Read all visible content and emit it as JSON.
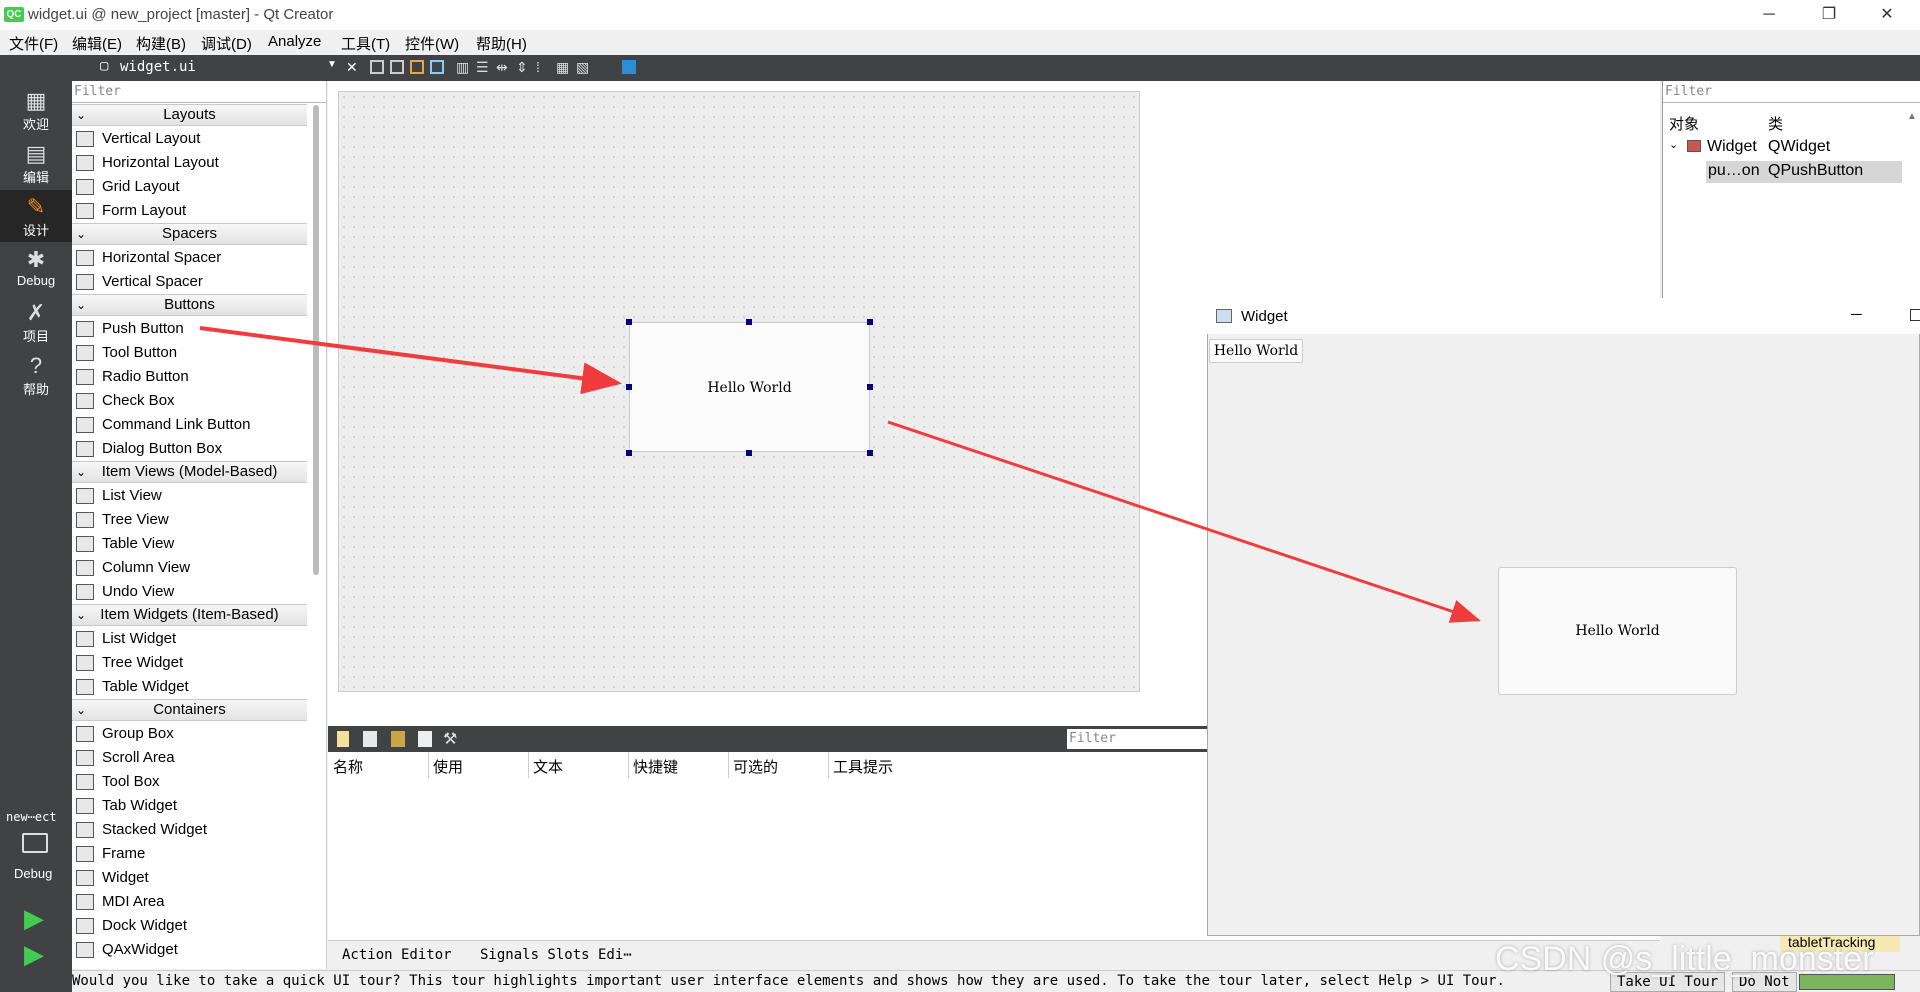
{
  "window": {
    "title": "widget.ui @ new_project [master] - Qt Creator",
    "logo": "QC",
    "minimize": "─",
    "restore": "❐",
    "close": "✕"
  },
  "menu": [
    "文件(F)",
    "编辑(E)",
    "构建(B)",
    "调试(D)",
    "Analyze",
    "工具(T)",
    "控件(W)",
    "帮助(H)"
  ],
  "modes": [
    {
      "label": "欢迎",
      "icon": "grid-icon"
    },
    {
      "label": "编辑",
      "icon": "edit-doc-icon"
    },
    {
      "label": "设计",
      "icon": "pencil-icon"
    },
    {
      "label": "Debug",
      "icon": "bug-icon"
    },
    {
      "label": "项目",
      "icon": "wrench-icon"
    },
    {
      "label": "帮助",
      "icon": "help-icon"
    }
  ],
  "bottom_mode": {
    "project": "new⋯ect",
    "kit": "Debug"
  },
  "editor_toolbar": {
    "file": "widget.ui",
    "close": "✕"
  },
  "widget_box": {
    "filter_placeholder": "Filter",
    "categories": [
      {
        "name": "Layouts",
        "items": [
          "Vertical Layout",
          "Horizontal Layout",
          "Grid Layout",
          "Form Layout"
        ]
      },
      {
        "name": "Spacers",
        "items": [
          "Horizontal Spacer",
          "Vertical Spacer"
        ]
      },
      {
        "name": "Buttons",
        "items": [
          "Push Button",
          "Tool Button",
          "Radio Button",
          "Check Box",
          "Command Link Button",
          "Dialog Button Box"
        ]
      },
      {
        "name": "Item Views (Model-Based)",
        "items": [
          "List View",
          "Tree View",
          "Table View",
          "Column View",
          "Undo View"
        ]
      },
      {
        "name": "Item Widgets (Item-Based)",
        "items": [
          "List Widget",
          "Tree Widget",
          "Table Widget"
        ]
      },
      {
        "name": "Containers",
        "items": [
          "Group Box",
          "Scroll Area",
          "Tool Box",
          "Tab Widget",
          "Stacked Widget",
          "Frame",
          "Widget",
          "MDI Area",
          "Dock Widget",
          "QAxWidget"
        ]
      }
    ]
  },
  "form": {
    "button_text": "Hello World"
  },
  "object_inspector": {
    "filter_placeholder": "Filter",
    "col_object": "对象",
    "col_class": "类",
    "rows": [
      {
        "object": "Widget",
        "class": "QWidget"
      },
      {
        "object": "pu…on",
        "class": "QPushButton"
      }
    ]
  },
  "action_editor": {
    "filter_placeholder": "Filter",
    "columns": [
      "名称",
      "使用",
      "文本",
      "快捷键",
      "可选的",
      "工具提示"
    ],
    "tabs": [
      "Action Editor",
      "Signals Slots Edi⋯"
    ]
  },
  "running_window": {
    "title": "Widget",
    "minimize": "─",
    "button1": "Hello World",
    "button2": "Hello World"
  },
  "property_hint": "tabletTracking",
  "status": {
    "message": "Would you like to take a quick UI tour? This tour highlights important user interface elements and shows how they are used. To take the tour later, select Help > UI Tour.",
    "tour_button": "Take UI Tour",
    "dismiss_button": "Do Not"
  },
  "watermark": "CSDN @s_little_monster",
  "colors": {
    "annotation_arrow": "#f03c3c",
    "selection_handle": "#000080",
    "dark_sidebar": "#404244"
  }
}
